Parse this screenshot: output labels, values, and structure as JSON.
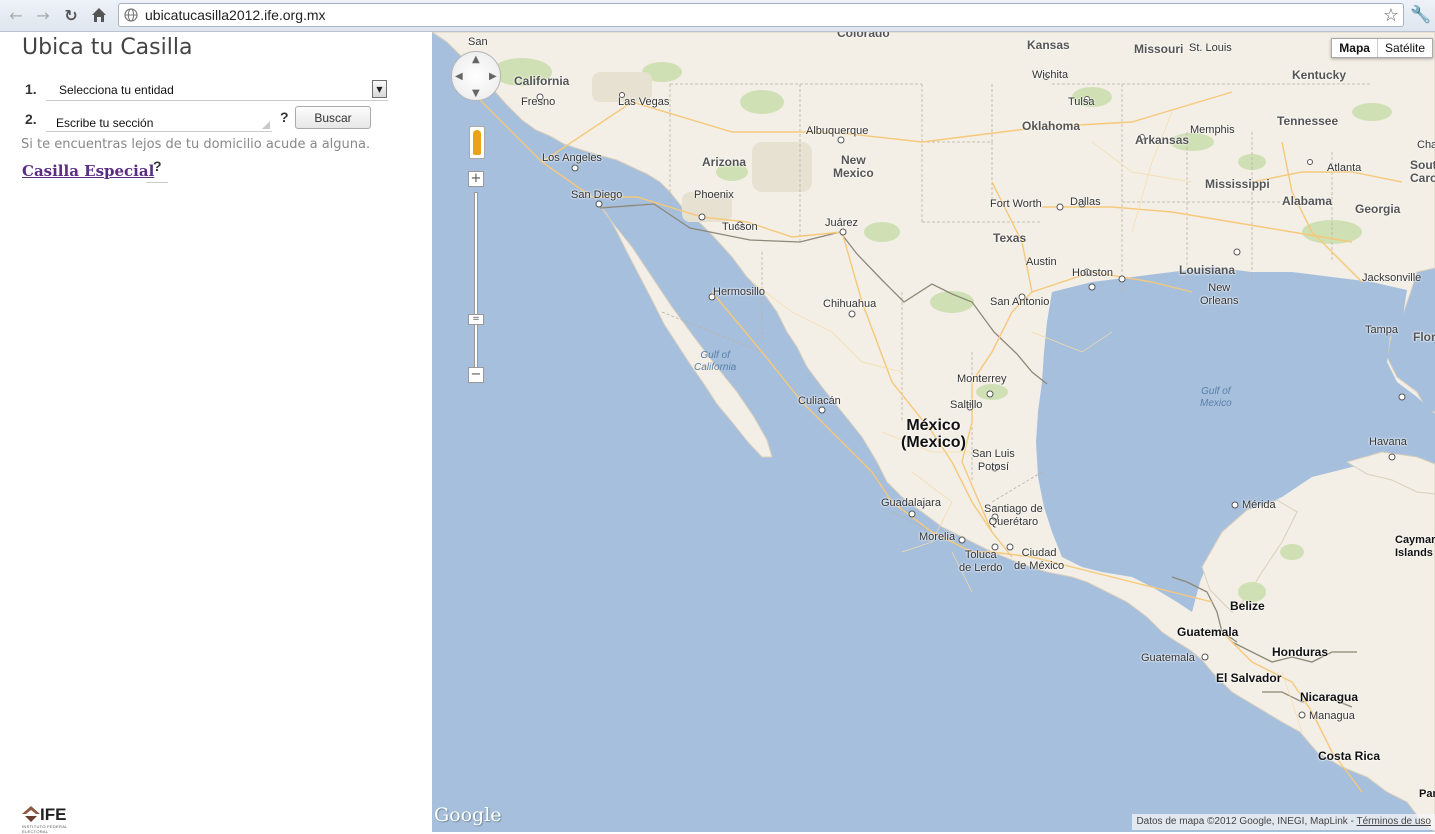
{
  "browser": {
    "url": "ubicatucasilla2012.ife.org.mx"
  },
  "panel": {
    "title": "Ubica tu Casilla",
    "step1_number": "1.",
    "step1_select_value": "Selecciona tu entidad",
    "step2_number": "2.",
    "step2_input_value": "Escribe tu sección",
    "help_mark": "?",
    "search_button": "Buscar",
    "hint": "Si te encuentras lejos de tu domicilio acude a alguna.",
    "special_link": "Casilla Especial",
    "logo_text": "IFE",
    "logo_subtext": "INSTITUTO FEDERAL ELECTORAL"
  },
  "map": {
    "type_buttons": {
      "map": "Mapa",
      "satellite": "Satélite"
    },
    "active_type": "Mapa",
    "zoom_in": "+",
    "zoom_out": "−",
    "google_logo": "Google",
    "attribution": "Datos de mapa ©2012 Google, INEGI, MapLink - ",
    "terms_link": "Términos de uso",
    "labels": {
      "san": "San",
      "colorado": "Colorado",
      "kansas": "Kansas",
      "missouri": "Missouri",
      "stlouis": "St. Louis",
      "california": "California",
      "wichita": "Wichita",
      "kentucky": "Kentucky",
      "fresno": "Fresno",
      "lasvegas": "Las Vegas",
      "tulsa": "Tulsa",
      "tennessee": "Tennessee",
      "memphis": "Memphis",
      "albuquerque": "Albuquerque",
      "oklahoma": "Oklahoma",
      "arkansas": "Arkansas",
      "losangeles": "Los Angeles",
      "arizona": "Arizona",
      "newmexico": "New\nMexico",
      "sandiego": "San Diego",
      "phoenix": "Phoenix",
      "atlanta": "Atlanta",
      "mississippi": "Mississippi",
      "alabama": "Alabama",
      "georgia": "Georgia",
      "fortworth": "Fort Worth",
      "dallas": "Dallas",
      "tucson": "Tucson",
      "juarez": "Juárez",
      "texas": "Texas",
      "austin": "Austin",
      "houston": "Houston",
      "louisiana": "Louisiana",
      "jacksonville": "Jacksonville",
      "neworleans": "New\nOrleans",
      "hermosillo": "Hermosillo",
      "chihuahua": "Chihuahua",
      "sanantonio": "San Antonio",
      "tampa": "Tampa",
      "florida": "Florida",
      "gulfcal": "Gulf of\nCalifornia",
      "monterrey": "Monterrey",
      "saltillo": "Saltillo",
      "gulfmex": "Gulf of\nMexico",
      "culiacan": "Culiacán",
      "mexico": "México\n(Mexico)",
      "havana": "Havana",
      "sanluis": "San Luis\nPotosí",
      "merida": "Mérida",
      "guadalajara": "Guadalajara",
      "santiago": "Santiago de\nQuerétaro",
      "morelia": "Morelia",
      "toluca": "Toluca\nde Lerdo",
      "ciudad": "Ciudad\nde México",
      "cayman": "Caymar\nIslands",
      "belize": "Belize",
      "guatemala_c": "Guatemala",
      "guatemala": "Guatemala",
      "honduras": "Honduras",
      "elsalvador": "El Salvador",
      "nicaragua": "Nicaragua",
      "managua": "Managua",
      "costarica": "Costa Rica",
      "pan": "Pan",
      "charlo": "Charlo",
      "south": "South\nCaro"
    }
  },
  "colors": {
    "land": "#f3efe6",
    "water": "#a6bfdd",
    "park": "#cfe0b4",
    "road": "#f6c87a",
    "link_visited": "#5a2d82"
  }
}
